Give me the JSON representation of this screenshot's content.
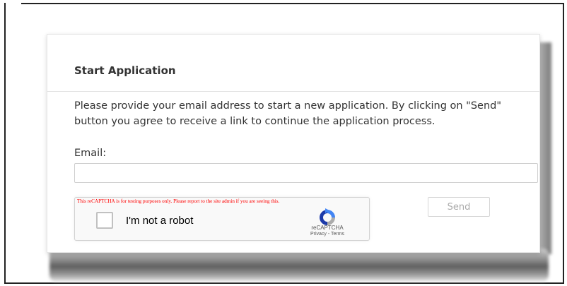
{
  "form": {
    "title": "Start Application",
    "intro": "Please provide your email address to start a new application. By clicking on \"Send\" button you agree to receive a link to continue the application process.",
    "email_label": "Email:",
    "email_value": "",
    "email_placeholder": "",
    "send_label": "Send"
  },
  "recaptcha": {
    "warning": "This reCAPTCHA is for testing purposes only. Please report to the site admin if you are seeing this.",
    "label": "I'm not a robot",
    "brand": "reCAPTCHA",
    "links": "Privacy - Terms",
    "icon": "recaptcha-logo"
  },
  "colors": {
    "warning_text": "#ff0000",
    "disabled_button_text": "#aaaaaa",
    "recaptcha_blue_dark": "#1c3aa9",
    "recaptcha_blue": "#4285f4",
    "recaptcha_gray": "#ababab"
  }
}
